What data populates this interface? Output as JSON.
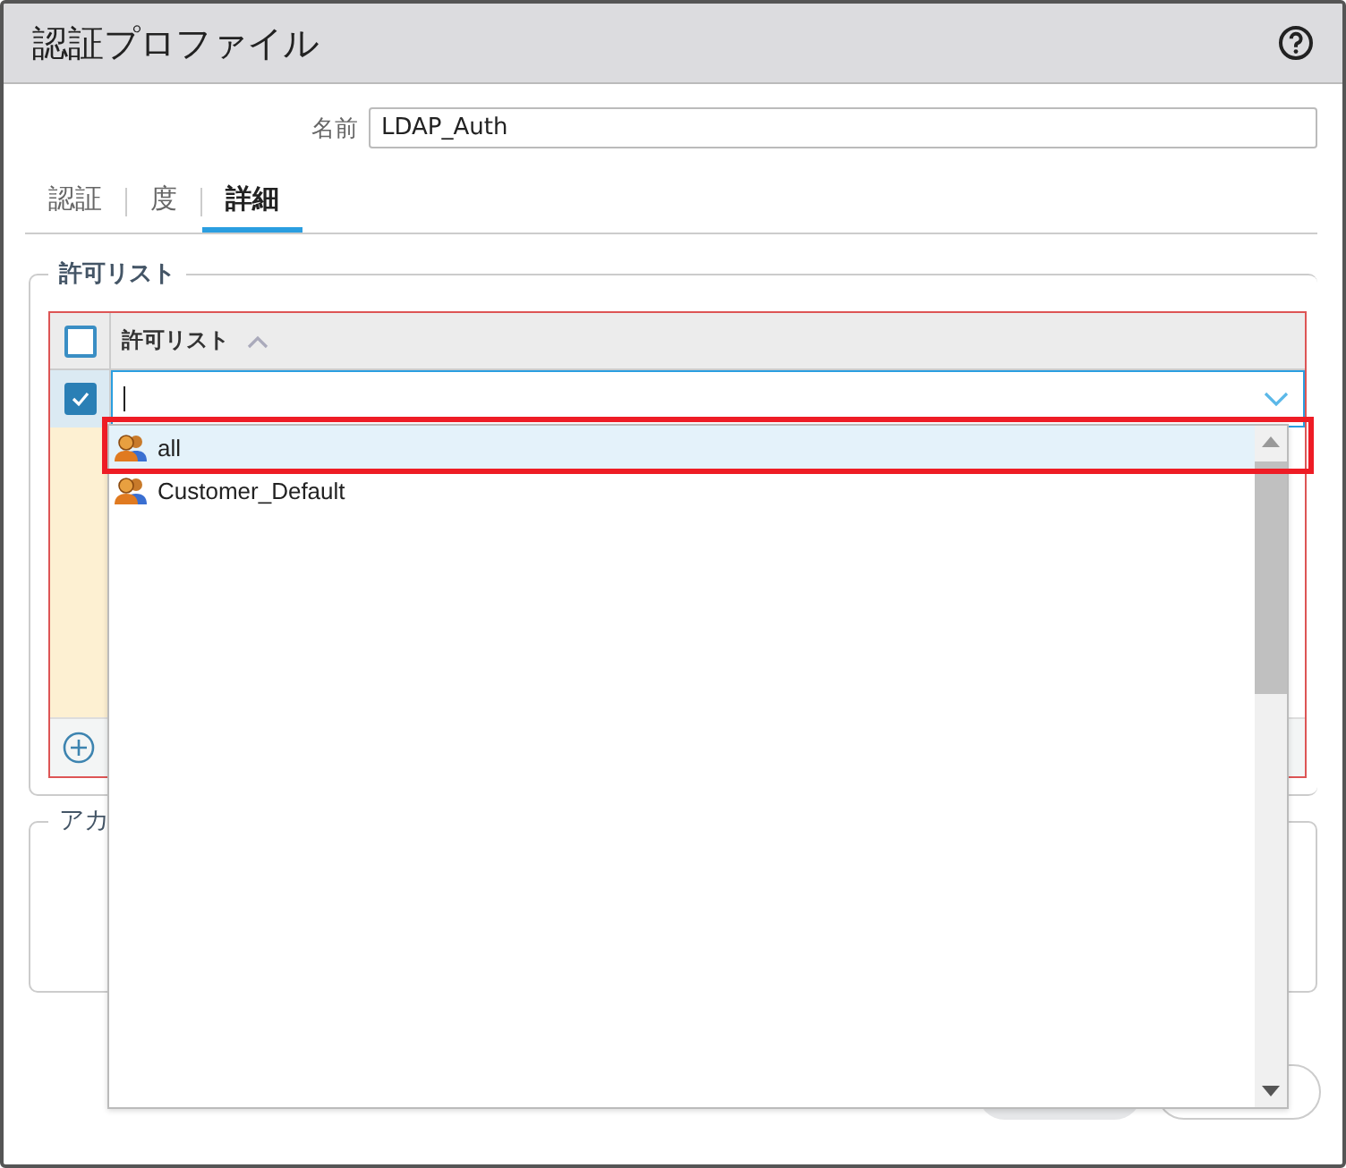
{
  "window": {
    "title": "認証プロファイル"
  },
  "name_field": {
    "label": "名前",
    "value": "LDAP_Auth"
  },
  "tabs": [
    {
      "label": "認証",
      "selected": false
    },
    {
      "label": "度",
      "selected": false
    },
    {
      "label": "詳細",
      "selected": true
    }
  ],
  "allow_list": {
    "legend": "許可リスト",
    "header_checked": false,
    "column": "許可リスト",
    "sorted": true,
    "rows": [
      {
        "checked": true,
        "value": ""
      }
    ]
  },
  "dropdown": {
    "items": [
      {
        "label": "all",
        "selected": true
      },
      {
        "label": "Customer_Default",
        "selected": false
      }
    ]
  },
  "account_section": {
    "legend": "アカ"
  }
}
